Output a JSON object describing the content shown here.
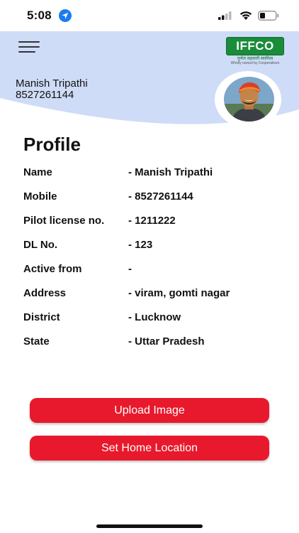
{
  "status_bar": {
    "time": "5:08"
  },
  "header": {
    "user_name": "Manish Tripathi",
    "user_mobile": "8527261144",
    "logo": {
      "word": "IFFCO",
      "hindi": "पुर्णतः सहकारी स्वामित्व",
      "subtitle": "Wholly owned by Cooperatives"
    }
  },
  "profile": {
    "title": "Profile",
    "rows": [
      {
        "label": "Name",
        "value": "- Manish Tripathi"
      },
      {
        "label": "Mobile",
        "value": "- 8527261144"
      },
      {
        "label": "Pilot license no.",
        "value": "- 1211222"
      },
      {
        "label": "DL No.",
        "value": "- 123"
      },
      {
        "label": "Active from",
        "value": "-"
      },
      {
        "label": "Address",
        "value": "- viram, gomti nagar"
      },
      {
        "label": "District",
        "value": "- Lucknow"
      },
      {
        "label": "State",
        "value": "- Uttar Pradesh"
      }
    ]
  },
  "actions": {
    "upload_label": "Upload Image",
    "home_location_label": "Set Home Location"
  },
  "colors": {
    "header_bg": "#cfdcf7",
    "button_bg": "#e8192c",
    "logo_green": "#1a8c3a"
  }
}
